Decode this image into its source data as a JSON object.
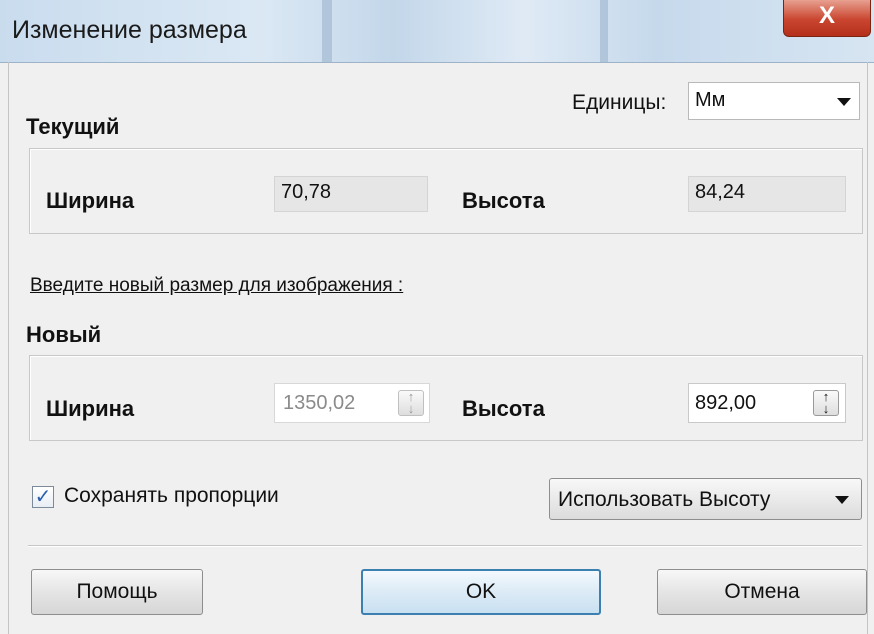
{
  "window": {
    "title": "Изменение размера",
    "close_label": "X"
  },
  "units": {
    "label": "Единицы:",
    "value": "Мм"
  },
  "current": {
    "title": "Текущий",
    "width_label": "Ширина",
    "width_value": "70,78",
    "height_label": "Высота",
    "height_value": "84,24"
  },
  "prompt": "Введите новый размер для изображения :",
  "new_size": {
    "title": "Новый",
    "width_label": "Ширина",
    "width_value": "1350,02",
    "height_label": "Высота",
    "height_value": "892,00"
  },
  "keep_proportions": {
    "label": "Сохранять пропорции",
    "checked": true
  },
  "mode_select": {
    "value": "Использовать Высоту"
  },
  "buttons": {
    "help": "Помощь",
    "ok": "OK",
    "cancel": "Отмена"
  },
  "colors": {
    "accent": "#3c7fb1",
    "close": "#c9452f",
    "title_bar": "#c9dcee"
  },
  "icons": {
    "close": "close-icon",
    "spin": "spin-arrows-icon",
    "check": "checkmark-icon",
    "dropdown": "chevron-down-icon"
  }
}
